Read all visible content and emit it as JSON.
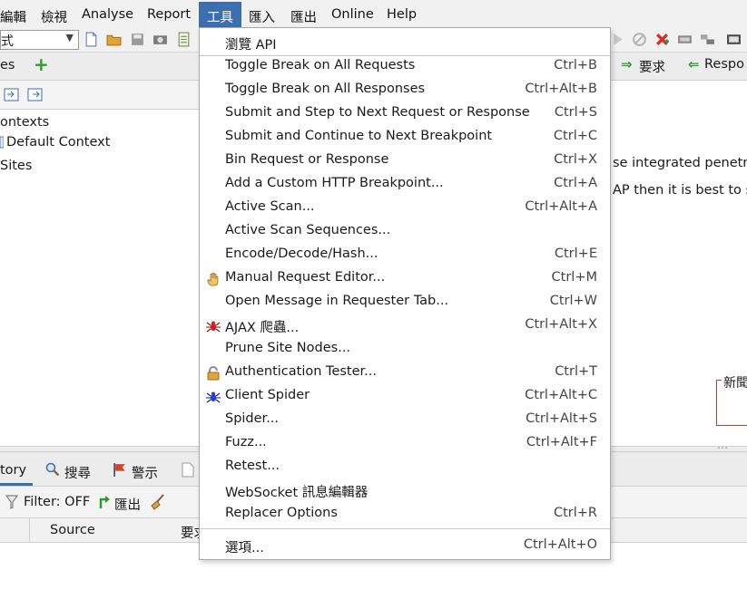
{
  "menubar": {
    "items": [
      {
        "label": "編輯"
      },
      {
        "label": "檢視"
      },
      {
        "label": "Analyse"
      },
      {
        "label": "Report"
      },
      {
        "label": "工具"
      },
      {
        "label": "匯入"
      },
      {
        "label": "匯出"
      },
      {
        "label": "Online"
      },
      {
        "label": "Help"
      }
    ]
  },
  "toolbar": {
    "mode_value": "式",
    "request_label": "要求",
    "response_label": "Respo"
  },
  "left_panel": {
    "tab_label": "es",
    "tree": {
      "contexts": "ontexts",
      "default_context": "Default Context",
      "sites": "Sites"
    }
  },
  "workspace": {
    "line1": "se integrated penetra",
    "line2": "AP then it is best to st",
    "news_label": "新聞"
  },
  "bottom_panel": {
    "tabs": {
      "history": "tory",
      "search": "搜尋",
      "alerts": "警示"
    },
    "filter_label": "Filter: OFF",
    "export_label": "匯出",
    "columns": {
      "source": "Source",
      "request": "要求"
    }
  },
  "tools_menu": {
    "items": [
      {
        "label": "瀏覽 API",
        "shortcut": ""
      },
      {
        "label": "Toggle Break on All Requests",
        "shortcut": "Ctrl+B"
      },
      {
        "label": "Toggle Break on All Responses",
        "shortcut": "Ctrl+Alt+B"
      },
      {
        "label": "Submit and Step to Next Request or Response",
        "shortcut": "Ctrl+S"
      },
      {
        "label": "Submit and Continue to Next Breakpoint",
        "shortcut": "Ctrl+C"
      },
      {
        "label": "Bin Request or Response",
        "shortcut": "Ctrl+X"
      },
      {
        "label": "Add a Custom HTTP Breakpoint...",
        "shortcut": "Ctrl+A"
      },
      {
        "label": "Active Scan...",
        "shortcut": "Ctrl+Alt+A"
      },
      {
        "label": "Active Scan Sequences...",
        "shortcut": ""
      },
      {
        "label": "Encode/Decode/Hash...",
        "shortcut": "Ctrl+E"
      },
      {
        "label": "Manual Request Editor...",
        "shortcut": "Ctrl+M",
        "icon": "hand-icon"
      },
      {
        "label": "Open Message in Requester Tab...",
        "shortcut": "Ctrl+W"
      },
      {
        "label": "AJAX 爬蟲...",
        "shortcut": "Ctrl+Alt+X",
        "icon": "red-spider-icon"
      },
      {
        "label": "Prune Site Nodes...",
        "shortcut": ""
      },
      {
        "label": "Authentication Tester...",
        "shortcut": "Ctrl+T",
        "icon": "padlock-icon"
      },
      {
        "label": "Client Spider",
        "shortcut": "Ctrl+Alt+C",
        "icon": "blue-spider-icon"
      },
      {
        "label": "Spider...",
        "shortcut": "Ctrl+Alt+S"
      },
      {
        "label": "Fuzz...",
        "shortcut": "Ctrl+Alt+F"
      },
      {
        "label": "Retest...",
        "shortcut": ""
      },
      {
        "label": "WebSocket 訊息編輯器",
        "shortcut": ""
      },
      {
        "label": "Replacer Options",
        "shortcut": "Ctrl+R"
      },
      {
        "label": "選項...",
        "shortcut": "Ctrl+Alt+O"
      }
    ]
  },
  "colors": {
    "active_menu": "#3b6fb0",
    "green_arrow": "#2d9a2d",
    "alert_flag": "#d8402a",
    "news_border": "#c0392b"
  }
}
